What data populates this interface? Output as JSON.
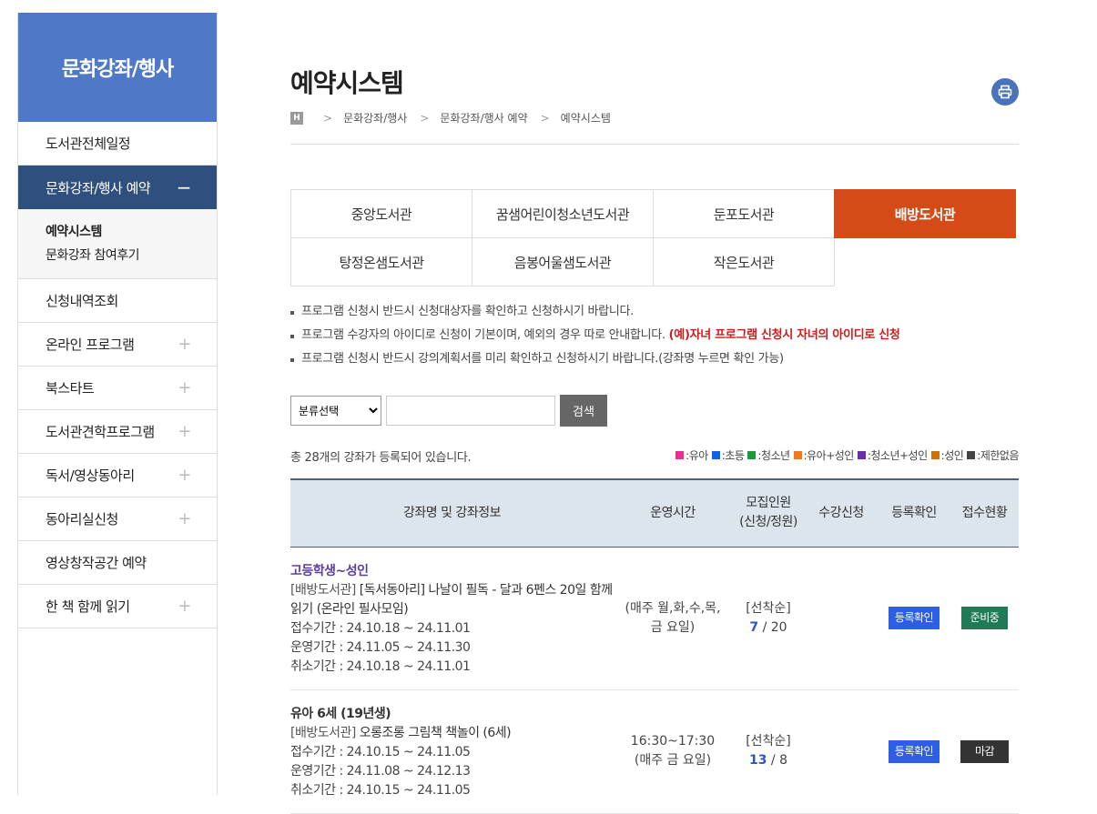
{
  "sidebar": {
    "title": "문화강좌/행사",
    "items": [
      {
        "label": "도서관전체일정",
        "plus": ""
      },
      {
        "label": "문화강좌/행사 예약",
        "plus": "−"
      },
      {
        "label": "신청내역조회",
        "plus": ""
      },
      {
        "label": "온라인 프로그램",
        "plus": "+"
      },
      {
        "label": "북스타트",
        "plus": "+"
      },
      {
        "label": "도서관견학프로그램",
        "plus": "+"
      },
      {
        "label": "독서/영상동아리",
        "plus": "+"
      },
      {
        "label": "동아리실신청",
        "plus": "+"
      },
      {
        "label": "영상창작공간 예약",
        "plus": ""
      },
      {
        "label": "한 책 함께 읽기",
        "plus": "+"
      }
    ],
    "sub": [
      "예약시스템",
      "문화강좌 참여후기"
    ]
  },
  "page": {
    "title": "예약시스템",
    "breadcrumb": {
      "home": "H",
      "items": [
        "문화강좌/행사",
        "문화강좌/행사 예약",
        "예약시스템"
      ],
      "sep": ">"
    }
  },
  "tabs": {
    "row1": [
      "중앙도서관",
      "꿈샘어린이청소년도서관",
      "둔포도서관",
      "배방도서관"
    ],
    "row2": [
      "탕정온샘도서관",
      "음봉어울샘도서관",
      "작은도서관"
    ]
  },
  "notice": {
    "line1": "프로그램 신청시 반드시 신청대상자를 확인하고 신청하시기 바랍니다.",
    "line2": "프로그램 수강자의 아이디로 신청이 기본이며, 예외의 경우 따로 안내합니다.",
    "line2_red": "(예)자녀 프로그램 신청시 자녀의 아이디로 신청",
    "line3": "프로그램 신청시 반드시 강의계획서를 미리 확인하고 신청하시기 바랍니다.(강좌명 누르면 확인 가능)"
  },
  "search": {
    "select": "분류선택",
    "button": "검색"
  },
  "count": "총 28개의 강좌가 등록되어 있습니다.",
  "legend": [
    {
      "label": ":유아",
      "color": "#e8308c"
    },
    {
      "label": ":초등",
      "color": "#1162e8"
    },
    {
      "label": ":청소년",
      "color": "#1a9a3a"
    },
    {
      "label": ":유아+성인",
      "color": "#f07a1a"
    },
    {
      "label": ":청소년+성인",
      "color": "#6a2fa0"
    },
    {
      "label": ":성인",
      "color": "#d0700a"
    },
    {
      "label": ":제한없음",
      "color": "#444444"
    }
  ],
  "table": {
    "headers": [
      "강좌명 및 강좌정보",
      "운영시간",
      "모집인원",
      "(신청/정원)",
      "수강신청",
      "등록확인",
      "접수현황"
    ],
    "rows": [
      {
        "target": "고등학생~성인",
        "lib": "[배방도서관]",
        "title": "[독서동아리] 나날이 필독 - 달과 6펜스 20일 함께 읽기 (온라인 필사모임)",
        "apply": "접수기간 : 24.10.18 ~ 24.11.01",
        "run": "운영기간 : 24.11.05 ~ 24.11.30",
        "cancel": "취소기간 : 24.10.18 ~ 24.11.01",
        "time1": "",
        "time2": "(매주 월,화,수,목,금 요일)",
        "method": "[선착순]",
        "applied": "7",
        "cap": " / 20",
        "reg": "등록확인",
        "status": "준비중"
      },
      {
        "target": "유아 6세 (19년생)",
        "lib": "[배방도서관]",
        "title": "오롱조롱 그림책 책놀이 (6세)",
        "apply": "접수기간 : 24.10.15 ~ 24.11.05",
        "run": "운영기간 : 24.11.08 ~ 24.12.13",
        "cancel": "취소기간 : 24.10.15 ~ 24.11.05",
        "time1": "16:30~17:30",
        "time2": "(매주 금 요일)",
        "method": "[선착순]",
        "applied": "13",
        "cap": " / 8",
        "reg": "등록확인",
        "status": "마감"
      }
    ]
  }
}
